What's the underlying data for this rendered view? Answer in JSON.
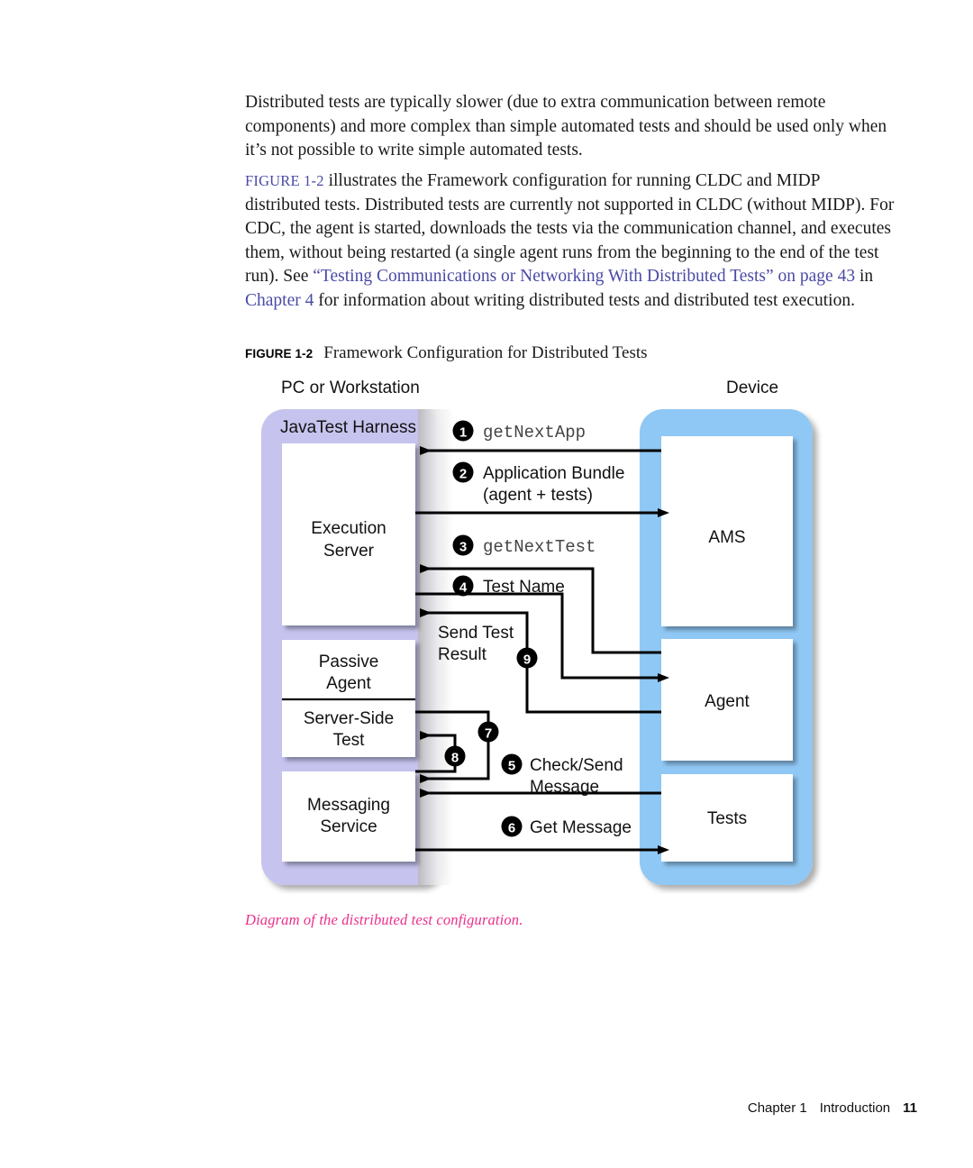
{
  "document": {
    "body_paragraphs": [
      {
        "id": "p1",
        "runs": [
          {
            "text": "Distributed tests are typically slower (due to extra communication between remote components) and more complex than simple automated tests and should be used only when it’s not possible to write simple automated tests.",
            "style": "plain"
          }
        ]
      },
      {
        "id": "p2",
        "runs": [
          {
            "text": "FIGURE 1-2",
            "style": "figref"
          },
          {
            "text": " illustrates the Framework configuration for running CLDC and MIDP distributed tests. Distributed tests are currently not supported in CLDC (without MIDP). For CDC, the agent is started, downloads the tests via the communication channel, and executes them, without being restarted (a single agent runs from the beginning to the end of the test run). See ",
            "style": "plain"
          },
          {
            "text": "“Testing Communications or Networking With Distributed Tests” on page 43",
            "style": "link"
          },
          {
            "text": " in ",
            "style": "plain"
          },
          {
            "text": "Chapter 4",
            "style": "link"
          },
          {
            "text": " for information about writing distributed tests and distributed test execution.",
            "style": "plain"
          }
        ]
      }
    ],
    "figure": {
      "label": "FIGURE 1-2",
      "title": "Framework Configuration for Distributed Tests",
      "caption": "Diagram of the distributed test configuration.",
      "caption_color": "#ec2f8a"
    },
    "footer": {
      "chapter": "Chapter 1",
      "section": "Introduction",
      "page_number": "11"
    }
  },
  "chart_data": {
    "type": "diagram",
    "title": "Framework Configuration for Distributed Tests",
    "colors": {
      "workstation_fill": "#c6c4ee",
      "device_fill": "#90c8f5",
      "node_fill": "#ffffff",
      "line": "#000000",
      "badge_fill": "#000000",
      "badge_text": "#ffffff"
    },
    "containers": [
      {
        "id": "workstation",
        "label": "PC or Workstation",
        "fill": "#c6c4ee",
        "nodes": [
          {
            "id": "harness",
            "label": "JavaTest Harness",
            "type": "group-title"
          },
          {
            "id": "execution-server",
            "label": "Execution Server"
          },
          {
            "id": "passive-agent",
            "label": "Passive Agent"
          },
          {
            "id": "server-side-test",
            "label": "Server-Side Test"
          },
          {
            "id": "messaging-service",
            "label": "Messaging Service"
          }
        ]
      },
      {
        "id": "device",
        "label": "Device",
        "fill": "#90c8f5",
        "nodes": [
          {
            "id": "ams",
            "label": "AMS"
          },
          {
            "id": "agent",
            "label": "Agent"
          },
          {
            "id": "tests",
            "label": "Tests"
          }
        ]
      }
    ],
    "flows": [
      {
        "step": "1",
        "label": "getNextApp",
        "mono": true,
        "from": "ams",
        "to": "execution-server",
        "direction": "left"
      },
      {
        "step": "2",
        "label": "Application Bundle\n(agent + tests)",
        "mono": false,
        "from": "execution-server",
        "to": "ams",
        "direction": "right"
      },
      {
        "step": "3",
        "label": "getNextTest",
        "mono": true,
        "from": "agent",
        "to": "execution-server",
        "direction": "left"
      },
      {
        "step": "4",
        "label": "Test Name",
        "mono": false,
        "from": "execution-server",
        "to": "agent",
        "direction": "right"
      },
      {
        "step": "5",
        "label": "Check/Send Message",
        "mono": false,
        "from": "tests",
        "to": "messaging-service",
        "direction": "left"
      },
      {
        "step": "6",
        "label": "Get Message",
        "mono": false,
        "from": "messaging-service",
        "to": "tests",
        "direction": "right"
      },
      {
        "step": "7",
        "label": "",
        "mono": false,
        "from": "server-side-test",
        "to": "messaging-service",
        "direction": "left"
      },
      {
        "step": "8",
        "label": "",
        "mono": false,
        "from": "messaging-service",
        "to": "server-side-test",
        "direction": "left"
      },
      {
        "step": "9",
        "label": "Send Test Result",
        "mono": false,
        "from": "agent",
        "to": "execution-server",
        "direction": "left"
      }
    ],
    "labels": {
      "workstation": "PC or Workstation",
      "device": "Device",
      "harness": "JavaTest Harness",
      "execution_server_line1": "Execution",
      "execution_server_line2": "Server",
      "passive_agent_line1": "Passive",
      "passive_agent_line2": "Agent",
      "server_side_test_line1": "Server-Side",
      "server_side_test_line2": "Test",
      "messaging_service_line1": "Messaging",
      "messaging_service_line2": "Service",
      "ams": "AMS",
      "agent": "Agent",
      "tests": "Tests",
      "step1": "1",
      "step1_text": "getNextApp",
      "step2": "2",
      "step2_text_l1": "Application Bundle",
      "step2_text_l2": "(agent + tests)",
      "step3": "3",
      "step3_text": "getNextTest",
      "step4": "4",
      "step4_text": "Test Name",
      "step5": "5",
      "step5_text_l1": "Check/Send",
      "step5_text_l2": "Message",
      "step6": "6",
      "step6_text": "Get Message",
      "step7": "7",
      "step8": "8",
      "step9": "9",
      "step9_text_l1": "Send Test",
      "step9_text_l2": "Result"
    }
  }
}
